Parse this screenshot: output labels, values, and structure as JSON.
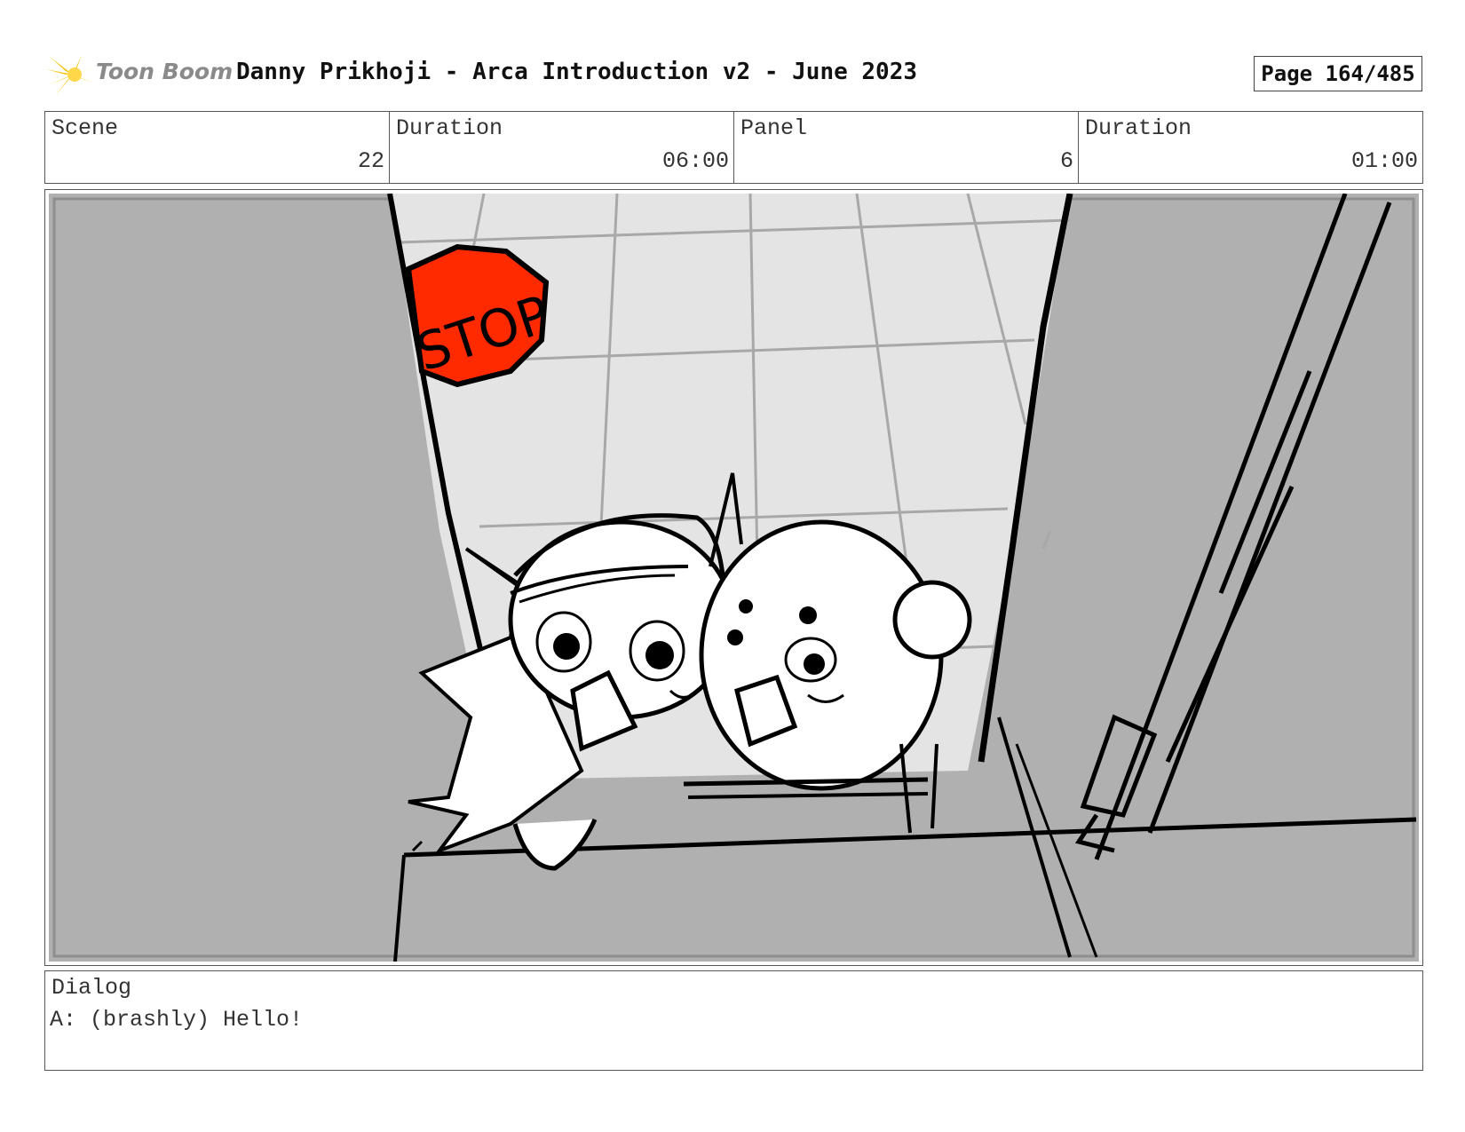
{
  "header": {
    "logo_text": "Toon Boom",
    "title": "Danny Prikhoji - Arca Introduction v2 - June 2023",
    "page": "Page 164/485"
  },
  "info": {
    "scene_label": "Scene",
    "scene_value": "22",
    "scene_duration_label": "Duration",
    "scene_duration_value": "06:00",
    "panel_label": "Panel",
    "panel_value": "6",
    "panel_duration_label": "Duration",
    "panel_duration_value": "01:00"
  },
  "panel": {
    "sign_text": "STOP",
    "colors": {
      "wall": "#b0b0b0",
      "ceiling": "#e4e4e4",
      "sign": "#ff2a00",
      "ink": "#000000"
    }
  },
  "dialog": {
    "label": "Dialog",
    "text": "A: (brashly) Hello!"
  }
}
